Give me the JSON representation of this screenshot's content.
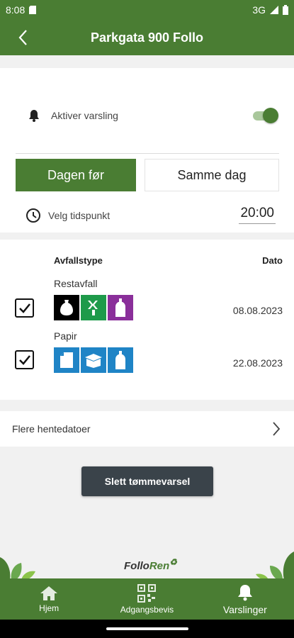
{
  "status_bar": {
    "time": "8:08",
    "network": "3G"
  },
  "header": {
    "title": "Parkgata 900 Follo"
  },
  "notification": {
    "label": "Aktiver varsling",
    "enabled": true
  },
  "segment": {
    "option_1": "Dagen før",
    "option_2": "Samme dag",
    "selected": "Dagen før"
  },
  "time_picker": {
    "label": "Velg tidspunkt",
    "value": "20:00"
  },
  "table": {
    "col_type": "Avfallstype",
    "col_date": "Dato",
    "rows": [
      {
        "name": "Restavfall",
        "date": "08.08.2023",
        "checked": true,
        "colors": [
          "#000000",
          "#1e9a4a",
          "#8a2f9a"
        ]
      },
      {
        "name": "Papir",
        "date": "22.08.2023",
        "checked": true,
        "colors": [
          "#1f84c6",
          "#1f84c6",
          "#1f84c6"
        ]
      }
    ]
  },
  "more_dates": {
    "label": "Flere hentedatoer"
  },
  "delete_button": {
    "label": "Slett tømmevarsel"
  },
  "logo": {
    "part1": "Follo",
    "part2": "Ren"
  },
  "bottom_nav": {
    "items": [
      {
        "label": "Hjem",
        "icon": "home-icon"
      },
      {
        "label": "Adgangsbevis",
        "icon": "qr-code-icon"
      },
      {
        "label": "Varslinger",
        "icon": "bell-icon",
        "active": true
      }
    ]
  },
  "colors": {
    "brand_green": "#4a7d33",
    "dark_button": "#3a434a"
  }
}
